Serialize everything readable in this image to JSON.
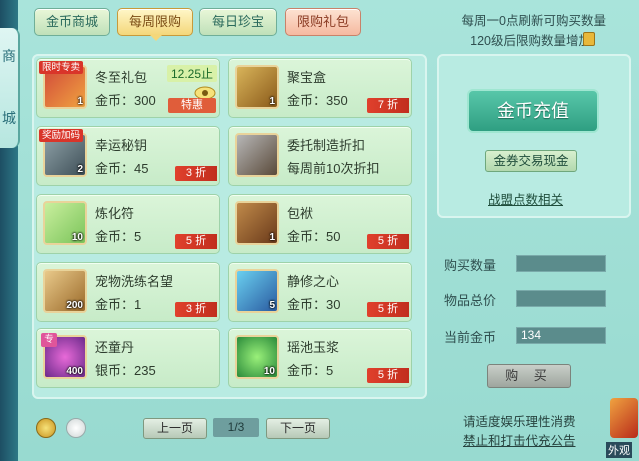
{
  "left_tab": {
    "chars": [
      "商",
      "城"
    ]
  },
  "tabs": [
    {
      "label": "金币商城"
    },
    {
      "label": "每周限购"
    },
    {
      "label": "每日珍宝"
    },
    {
      "label": "限购礼包"
    }
  ],
  "notice": {
    "line1": "每周一0点刷新可购买数量",
    "line2": "120级后限购数量增加"
  },
  "items": [
    {
      "name": "冬至礼包",
      "price": "金币：300",
      "qty": "1",
      "tag": "限时专卖",
      "deadline": "12.25止",
      "badge": "特惠"
    },
    {
      "name": "聚宝盒",
      "price": "金币：350",
      "qty": "1",
      "badge": "7 折"
    },
    {
      "name": "幸运秘钥",
      "price": "金币：45",
      "qty": "2",
      "tag": "奖励加码",
      "badge": "3 折"
    },
    {
      "name": "委托制造折扣",
      "price": "每周前10次折扣",
      "qty": "",
      "badge": ""
    },
    {
      "name": "炼化符",
      "price": "金币：5",
      "qty": "10",
      "badge": "5 折"
    },
    {
      "name": "包袱",
      "price": "金币：50",
      "qty": "1",
      "badge": "5 折"
    },
    {
      "name": "宠物洗练名望",
      "price": "金币：1",
      "qty": "200",
      "badge": "3 折"
    },
    {
      "name": "静修之心",
      "price": "金币：30",
      "qty": "5",
      "badge": "5 折"
    },
    {
      "name": "还童丹",
      "price": "银币：235",
      "qty": "400",
      "tag": "专",
      "badge": ""
    },
    {
      "name": "瑶池玉浆",
      "price": "金币：5",
      "qty": "10",
      "badge": "5 折"
    }
  ],
  "right": {
    "recharge": "金币充值",
    "exchange": "金券交易现金",
    "alliance": "战盟点数相关"
  },
  "form": {
    "qty_label": "购买数量",
    "total_label": "物品总价",
    "gold_label": "当前金币",
    "gold_value": "134",
    "buy": "购 买"
  },
  "pager": {
    "prev": "上一页",
    "page": "1/3",
    "next": "下一页"
  },
  "footer": {
    "line1": "请适度娱乐理性消费",
    "line2": "禁止和打击代充公告"
  },
  "corner_label": "外观"
}
